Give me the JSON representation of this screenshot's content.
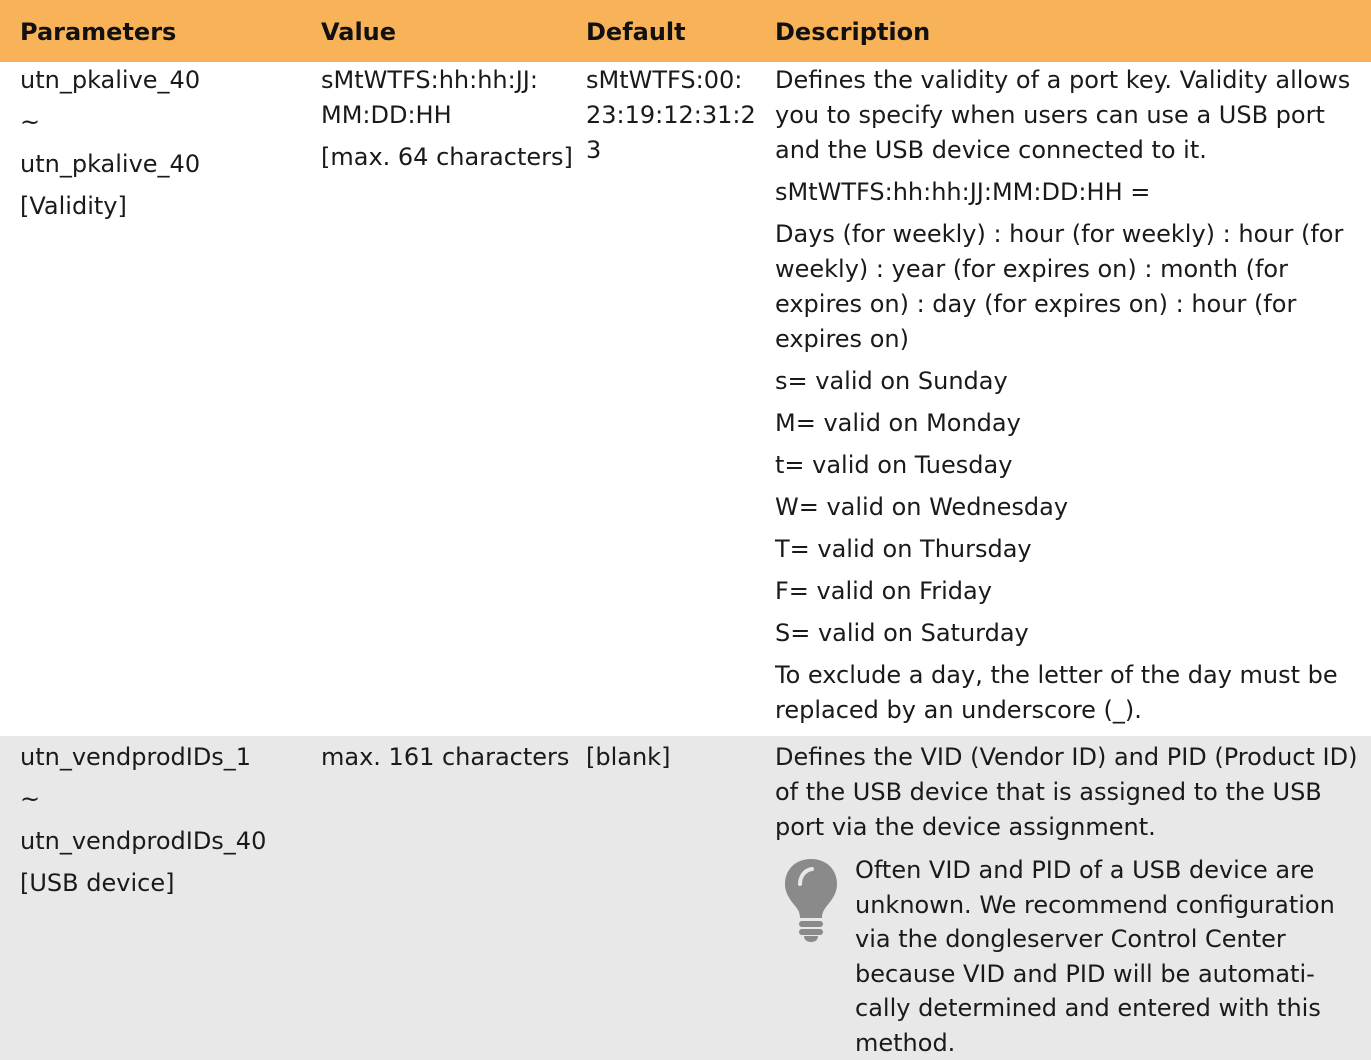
{
  "header": {
    "parameters": "Parameters",
    "value": "Value",
    "default": "Default",
    "description": "Description"
  },
  "rows": [
    {
      "param": {
        "line1": "utn_pkalive_40",
        "tilde": "~",
        "line2": "utn_pkalive_40",
        "name": "[Validity]"
      },
      "value": {
        "line1": "sMtWTFS:hh:hh:JJ:",
        "line2": "MM:DD:HH",
        "note": "[max. 64 characters]"
      },
      "default": {
        "line1": "sMtWTFS:00:",
        "line2": "23:19:12:31:2",
        "line3": "3"
      },
      "description": {
        "intro_1": "Defines the validity of a port key. Validity allows",
        "intro_2": "you to specify when users can use a USB port",
        "intro_3": "and the USB device connected to it.",
        "format": "sMtWTFS:hh:hh:JJ:MM:DD:HH =",
        "meaning_1": "Days (for weekly) : hour (for weekly) : hour (for",
        "meaning_2": "weekly) : year (for expires on) : month (for",
        "meaning_3": "expires on) : day (for expires on) : hour (for",
        "meaning_4": "expires on)",
        "days": [
          "s= valid on Sunday",
          "M= valid on Monday",
          "t= valid on Tuesday",
          "W= valid on Wednesday",
          "T= valid on Thursday",
          "F= valid on Friday",
          "S= valid on Saturday"
        ],
        "exclude_1": "To exclude a day, the letter of the day must be",
        "exclude_2": "replaced by an underscore (_)."
      }
    },
    {
      "param": {
        "line1": "utn_vendprodIDs_1",
        "tilde": "~",
        "line2": "utn_vendprodIDs_40",
        "name": "[USB device]"
      },
      "value": {
        "line1": "max. 161 characters"
      },
      "default": {
        "line1": "[blank]"
      },
      "description": {
        "intro_1": "Defines the VID (Vendor ID) and PID (Product ID)",
        "intro_2": "of the USB device that is assigned to the USB",
        "intro_3": "port via the device assignment.",
        "tip_icon": "lightbulb-icon",
        "tip_1": "Often VID and PID of a USB device are",
        "tip_2": "unknown. We recommend configuration",
        "tip_3": "via the dongleserver Control Center",
        "tip_4": "because VID and PID will be automati-",
        "tip_5": "cally determined and entered with this",
        "tip_6": "method."
      }
    }
  ],
  "colors": {
    "header_bg": "#f8b258",
    "row_alt_bg": "#e8e8e8",
    "icon_gray": "#8a8a8a"
  }
}
